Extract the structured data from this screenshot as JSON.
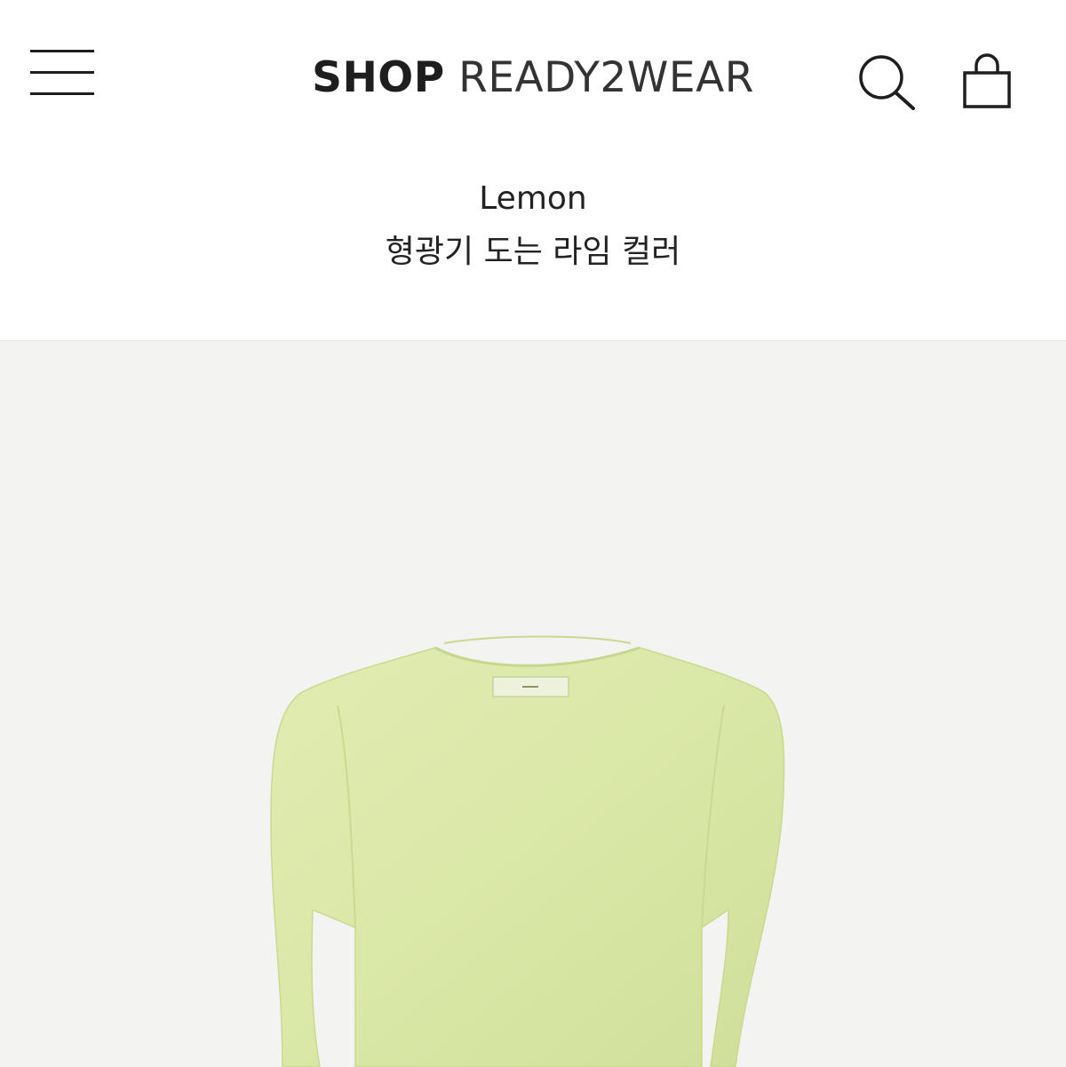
{
  "header": {
    "logo_bold": "SHOP",
    "logo_light": "READY2WEAR",
    "menu_icon": "hamburger-menu-icon",
    "search_icon": "search-icon",
    "bag_icon": "shopping-bag-icon"
  },
  "product": {
    "color_name": "Lemon",
    "color_description": "형광기 도는 라임 컬러",
    "image_background": "#f3f3f1",
    "garment_color": "#dbe8a8"
  }
}
